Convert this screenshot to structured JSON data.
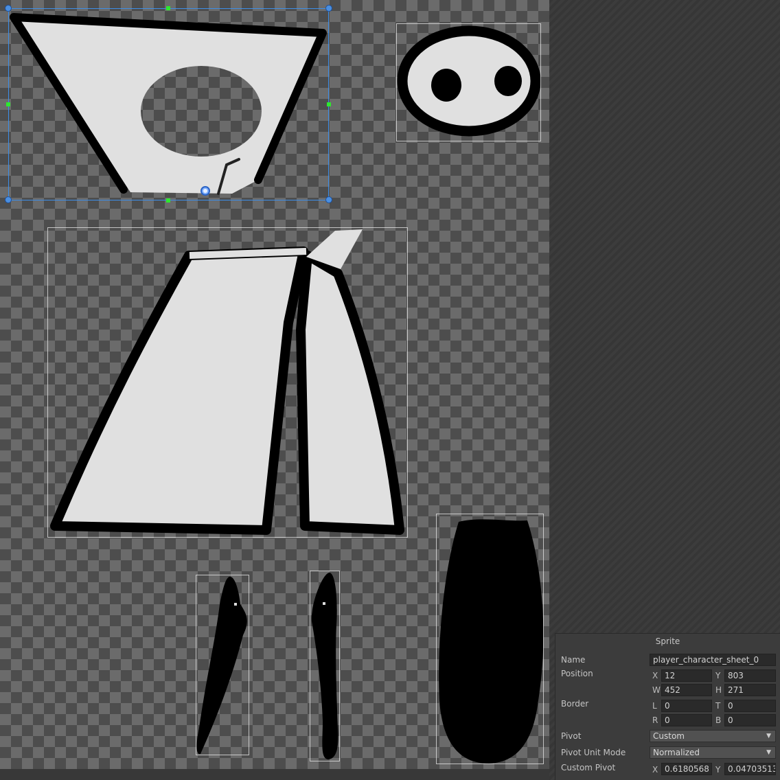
{
  "sprite_panel": {
    "title": "Sprite",
    "name_label": "Name",
    "name_value": "player_character_sheet_0",
    "position_label": "Position",
    "x_label": "X",
    "x_value": "12",
    "y_label": "Y",
    "y_value": "803",
    "w_label": "W",
    "w_value": "452",
    "h_label": "H",
    "h_value": "271",
    "border_label": "Border",
    "l_label": "L",
    "l_value": "0",
    "t_label": "T",
    "t_value": "0",
    "r_label": "R",
    "r_value": "0",
    "b_label": "B",
    "b_value": "0",
    "pivot_label": "Pivot",
    "pivot_value": "Custom",
    "pivot_unit_label": "Pivot Unit Mode",
    "pivot_unit_value": "Normalized",
    "custom_pivot_label": "Custom Pivot",
    "cx_label": "X",
    "cx_value": "0.6180568",
    "cy_label": "Y",
    "cy_value": "0.04703513"
  },
  "icons": {
    "pivot": "pivot-handle-icon",
    "dropdown": "chevron-down-icon"
  },
  "colors": {
    "selection": "#3d8ee8",
    "handle_mid": "#2ee82e",
    "sprite_fill": "#e0e0e0",
    "outline": "#000000"
  }
}
